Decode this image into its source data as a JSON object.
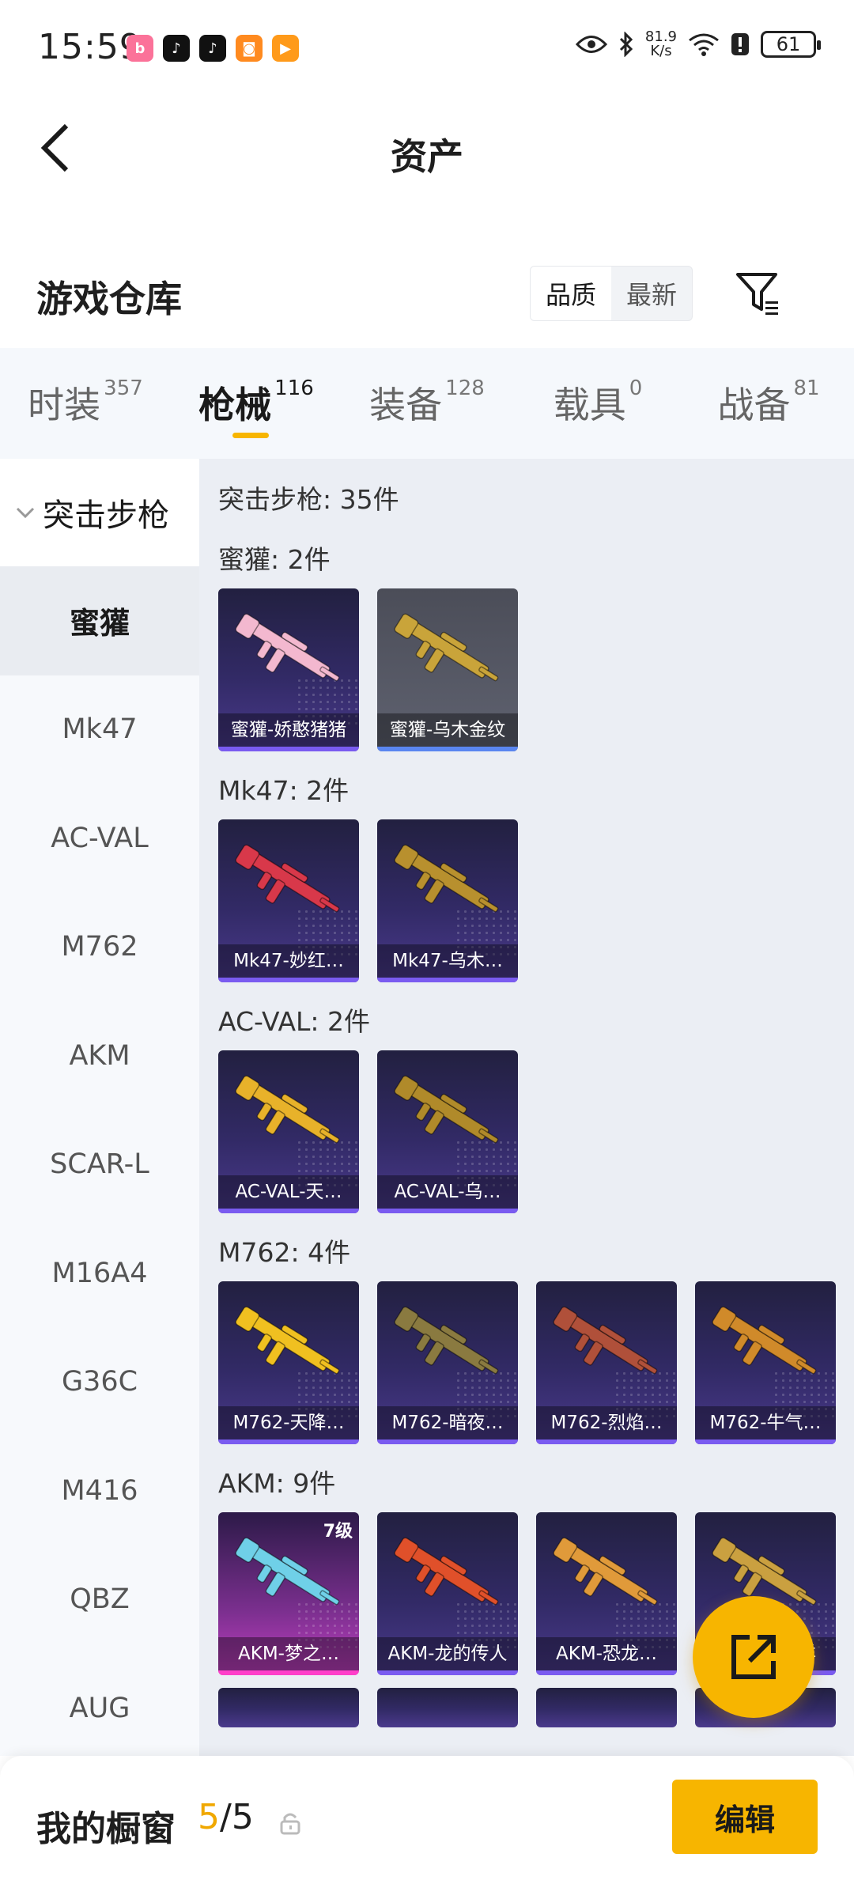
{
  "status_bar": {
    "time": "15:59",
    "net_speed_value": "81.9",
    "net_speed_unit": "K/s",
    "battery": "61",
    "app_icons": [
      "bilibili-icon",
      "tiktok-icon",
      "tiktok-icon",
      "game-icon",
      "video-icon"
    ]
  },
  "header": {
    "title": "资产"
  },
  "warehouse": {
    "title": "游戏仓库",
    "sort_options": [
      "品质",
      "最新"
    ],
    "active_sort": "品质"
  },
  "tabs": [
    {
      "label": "时装",
      "count": "357"
    },
    {
      "label": "枪械",
      "count": "116"
    },
    {
      "label": "装备",
      "count": "128"
    },
    {
      "label": "载具",
      "count": "0"
    },
    {
      "label": "战备",
      "count": "81"
    }
  ],
  "active_tab": "枪械",
  "sidebar": {
    "group": "突击步枪",
    "items": [
      "蜜獾",
      "Mk47",
      "AC-VAL",
      "M762",
      "AKM",
      "SCAR-L",
      "M16A4",
      "G36C",
      "M416",
      "QBZ",
      "AUG"
    ],
    "active_item": "蜜獾"
  },
  "content": {
    "category_title": "突击步枪: 35件",
    "sections": [
      {
        "title": "蜜獾: 2件",
        "items": [
          {
            "name": "蜜獾-娇憨猪猪",
            "color": "#f3b8cf"
          },
          {
            "name": "蜜獾-乌木金纹",
            "color": "#c9a43a"
          }
        ]
      },
      {
        "title": "Mk47: 2件",
        "items": [
          {
            "name": "Mk47-妙红…",
            "color": "#d8384a"
          },
          {
            "name": "Mk47-乌木…",
            "color": "#b8902e"
          }
        ]
      },
      {
        "title": "AC-VAL: 2件",
        "items": [
          {
            "name": "AC-VAL-天…",
            "color": "#e8b22a"
          },
          {
            "name": "AC-VAL-乌…",
            "color": "#b08a2a"
          }
        ]
      },
      {
        "title": "M762: 4件",
        "items": [
          {
            "name": "M762-天降…",
            "color": "#f0c020"
          },
          {
            "name": "M762-暗夜…",
            "color": "#8a7a40"
          },
          {
            "name": "M762-烈焰…",
            "color": "#b0503a"
          },
          {
            "name": "M762-牛气…",
            "color": "#d08a2a"
          }
        ]
      },
      {
        "title": "AKM: 9件",
        "items": [
          {
            "name": "AKM-梦之…",
            "color": "#6fd0e8",
            "level": "7级"
          },
          {
            "name": "AKM-龙的传人",
            "color": "#e0502a"
          },
          {
            "name": "AKM-恐龙…",
            "color": "#e09a3a"
          },
          {
            "name": "AKM-…平洋",
            "color": "#caa040"
          }
        ]
      }
    ]
  },
  "bottom_bar": {
    "title": "我的橱窗",
    "used": "5",
    "separator": "/",
    "total": "5",
    "edit_label": "编辑"
  },
  "colors": {
    "accent": "#f7b500",
    "tab_bg": "#f5f8fc",
    "content_bg": "#ebeef4"
  }
}
